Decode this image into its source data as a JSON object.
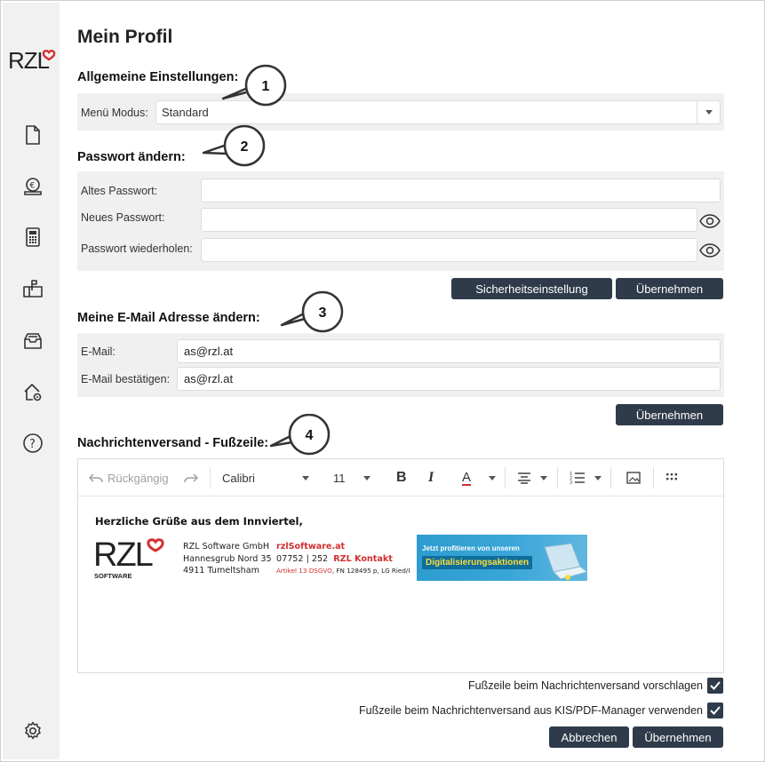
{
  "page": {
    "title": "Mein Profil",
    "brand": "RZL"
  },
  "general": {
    "title": "Allgemeine Einstellungen:",
    "menu_mode_label": "Menü Modus:",
    "menu_mode_value": "Standard"
  },
  "password": {
    "title": "Passwort ändern:",
    "old_label": "Altes Passwort:",
    "new_label": "Neues Passwort:",
    "repeat_label": "Passwort wiederholen:",
    "old_value": "",
    "new_value": "",
    "repeat_value": "",
    "security_button": "Sicherheitseinstellung",
    "apply_button": "Übernehmen"
  },
  "email": {
    "title": "Meine E-Mail Adresse ändern:",
    "email_label": "E-Mail:",
    "confirm_label": "E-Mail bestätigen:",
    "email_value": "as@rzl.at",
    "confirm_value": "as@rzl.at",
    "apply_button": "Übernehmen"
  },
  "footer": {
    "title": "Nachrichtenversand - Fußzeile:",
    "toolbar": {
      "undo": "Rückgängig",
      "font": "Calibri",
      "size": "11"
    },
    "signature": {
      "greeting": "Herzliche Grüße aus dem Innviertel,",
      "logo_sub": "SOFTWARE",
      "company": "RZL Software GmbH",
      "street": "Hannesgrub Nord 35",
      "city": "4911 Tumeltsham",
      "website": "rzlSoftware.at",
      "phone": "07752 | 252",
      "contact": "RZL Kontakt",
      "legal_link": "Artikel 13 DSGVO",
      "legal_rest": ", FN 128495 p, LG Ried/I",
      "banner_line1": "Jetzt profitieren von unseren",
      "banner_line2": "Digitalisierungsaktionen"
    },
    "check1_label": "Fußzeile beim Nachrichtenversand vorschlagen",
    "check2_label": "Fußzeile beim Nachrichtenversand aus KIS/PDF-Manager verwenden",
    "check1_checked": true,
    "check2_checked": true,
    "cancel_button": "Abbrechen",
    "apply_button": "Übernehmen"
  },
  "callouts": [
    "1",
    "2",
    "3",
    "4"
  ],
  "colors": {
    "button_bg": "#2f3b4a",
    "panel_bg": "#f0f0f0",
    "brand_red": "#d32f2f",
    "sidebar_bg": "#f1f1f1"
  },
  "icons": {
    "sidebar": [
      "document-icon",
      "coin-euro-icon",
      "calculator-icon",
      "mailbox-icon",
      "archive-box-icon",
      "home-settings-icon",
      "help-icon",
      "settings-gear-icon"
    ]
  }
}
